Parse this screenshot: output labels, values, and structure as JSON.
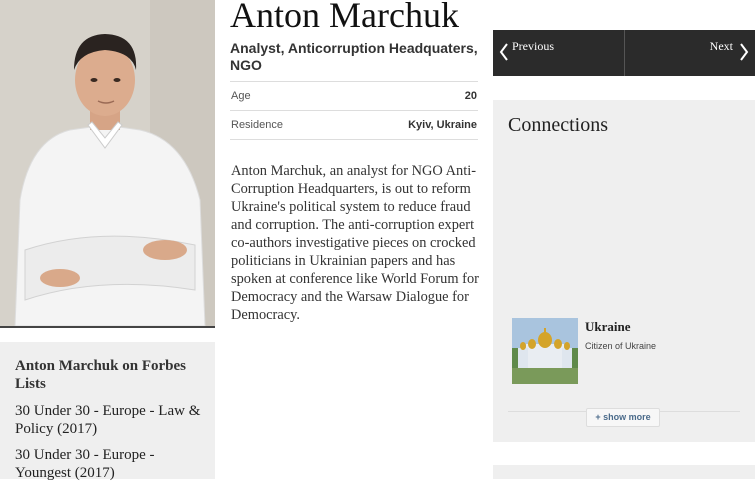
{
  "profile": {
    "name": "Anton Marchuk",
    "title": "Analyst, Anticorruption Headquaters, NGO",
    "stats": [
      {
        "label": "Age",
        "value": "20"
      },
      {
        "label": "Residence",
        "value": "Kyiv, Ukraine"
      }
    ],
    "bio": "Anton Marchuk, an analyst for NGO Anti-Corruption Headquarters, is out to reform Ukraine's political system to reduce fraud and corruption. The anti-corruption expert co-authors investigative pieces on crocked politicians in Ukrainian papers and has spoken at conference like World Forum for Democracy and the Warsaw Dialogue for Democracy."
  },
  "lists": {
    "title": "Anton Marchuk on Forbes Lists",
    "items": [
      "30 Under 30 - Europe - Law & Policy (2017)",
      "30 Under 30 - Europe - Youngest (2017)"
    ]
  },
  "nav": {
    "previous": "Previous",
    "next": "Next"
  },
  "connections": {
    "title": "Connections",
    "items": [
      {
        "name": "Ukraine",
        "subtitle": "Citizen of Ukraine",
        "icon": "cathedral-photo"
      }
    ],
    "show_more": "+ show more"
  }
}
